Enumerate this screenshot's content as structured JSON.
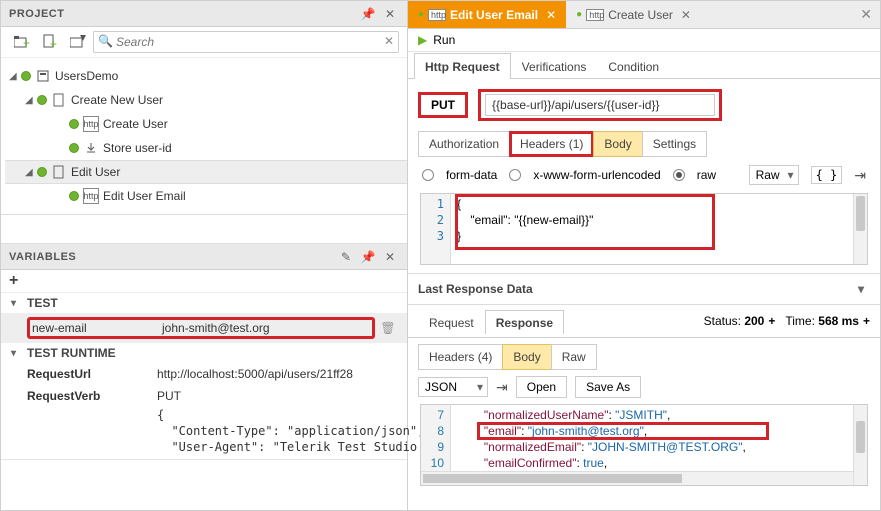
{
  "project": {
    "title": "PROJECT",
    "search_placeholder": "Search",
    "tree": {
      "root": "UsersDemo",
      "folder1": "Create New User",
      "file_create_user": "Create User",
      "file_store": "Store user-id",
      "folder2": "Edit User",
      "file_edit_email": "Edit User Email"
    }
  },
  "variables": {
    "title": "VARIABLES",
    "group_test": "TEST",
    "row_key": "new-email",
    "row_val": "john-smith@test.org",
    "group_runtime": "TEST RUNTIME",
    "req_url_k": "RequestUrl",
    "req_url_v": "http://localhost:5000/api/users/21ff28",
    "req_verb_k": "RequestVerb",
    "req_verb_v": "PUT",
    "headers_line1": "{",
    "headers_line2": "  \"Content-Type\": \"application/json\",",
    "headers_line3": "  \"User-Agent\": \"Telerik Test Studio fo"
  },
  "editor": {
    "tab_active": "Edit User Email",
    "tab_other": "Create User",
    "run": "Run",
    "main_tabs": {
      "http": "Http Request",
      "ver": "Verifications",
      "cond": "Condition"
    },
    "method": "PUT",
    "url": "{{base-url}}/api/users/{{user-id}}",
    "sub": {
      "auth": "Authorization",
      "headers": "Headers (1)",
      "body": "Body",
      "settings": "Settings"
    },
    "bodytype": {
      "form": "form-data",
      "xwww": "x-www-form-urlencoded",
      "raw": "raw",
      "rawsel": "Raw"
    },
    "body_code": {
      "l1": "{",
      "l2": "    \"email\": \"{{new-email}}\"",
      "l3": "}"
    },
    "lrd": "Last Response Data",
    "resp_tabs": {
      "req": "Request",
      "resp": "Response"
    },
    "status_label": "Status:",
    "status_val": "200",
    "time_label": "Time:",
    "time_val": "568 ms",
    "resp_sub": {
      "hdr": "Headers (4)",
      "body": "Body",
      "raw": "Raw"
    },
    "json_sel": "JSON",
    "open": "Open",
    "save": "Save As",
    "resp_code": {
      "g1": "7",
      "g2": "8",
      "g3": "9",
      "g4": "10",
      "l1a": "\"normalizedUserName\"",
      "l1b": ": ",
      "l1c": "\"JSMITH\"",
      "l1d": ",",
      "l2a": "\"email\"",
      "l2b": ": ",
      "l2c": "\"john-smith@test.org\"",
      "l2d": ",",
      "l3a": "\"normalizedEmail\"",
      "l3b": ": ",
      "l3c": "\"JOHN-SMITH@TEST.ORG\"",
      "l3d": ",",
      "l4a": "\"emailConfirmed\"",
      "l4b": ": ",
      "l4c": "true",
      "l4d": ","
    }
  }
}
